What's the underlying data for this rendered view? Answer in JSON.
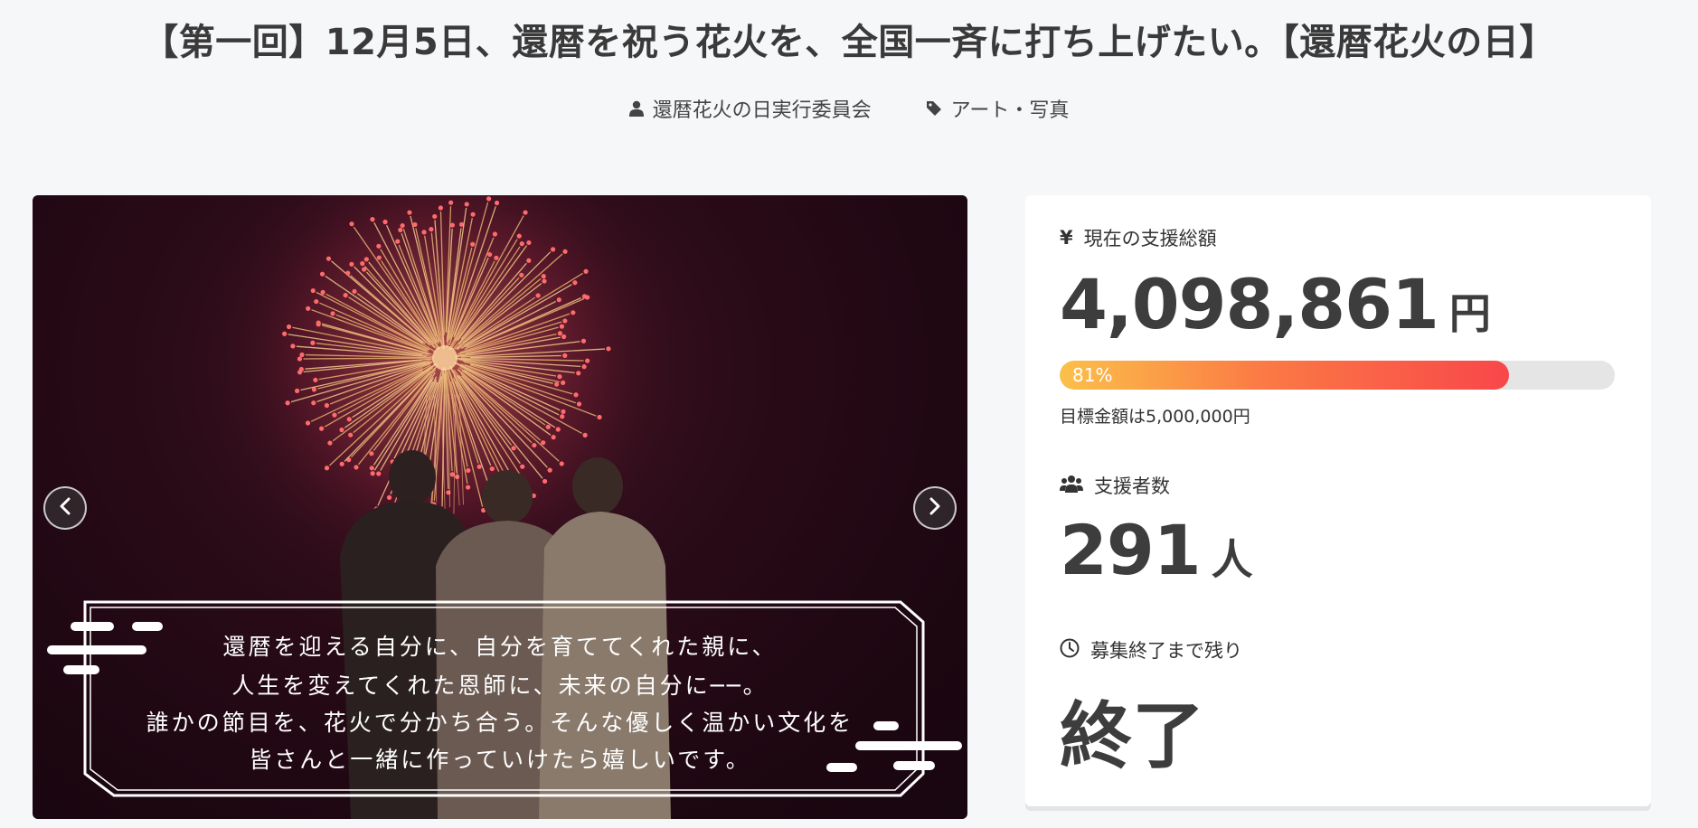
{
  "project": {
    "title": "【第一回】12月5日、還暦を祝う花火を、全国一斉に打ち上げたい。【還暦花火の日】",
    "owner": "還暦花火の日実行委員会",
    "category": "アート・写真"
  },
  "hero": {
    "caption_lines": [
      "還暦を迎える自分に、自分を育ててくれた親に、",
      "人生を変えてくれた恩師に、未来の自分に──。",
      "誰かの節目を、花火で分かち合う。そんな優しく温かい文化を",
      "皆さんと一緒に作っていけたら嬉しいです。"
    ]
  },
  "stats": {
    "total": {
      "icon": "yen-icon",
      "label": "現在の支援総額",
      "value": "4,098,861",
      "unit": "円"
    },
    "progress": {
      "percent": 81,
      "text": "81%",
      "goal_text": "目標金額は5,000,000円"
    },
    "supporters": {
      "icon": "users-icon",
      "label": "支援者数",
      "value": "291",
      "unit": "人"
    },
    "remaining": {
      "icon": "clock-icon",
      "label": "募集終了まで残り",
      "value": "終了"
    }
  },
  "colors": {
    "background": "#f6f7f9",
    "progress_start": "#fbc04a",
    "progress_end": "#f8474a",
    "progress_track": "#e5e5e5"
  }
}
